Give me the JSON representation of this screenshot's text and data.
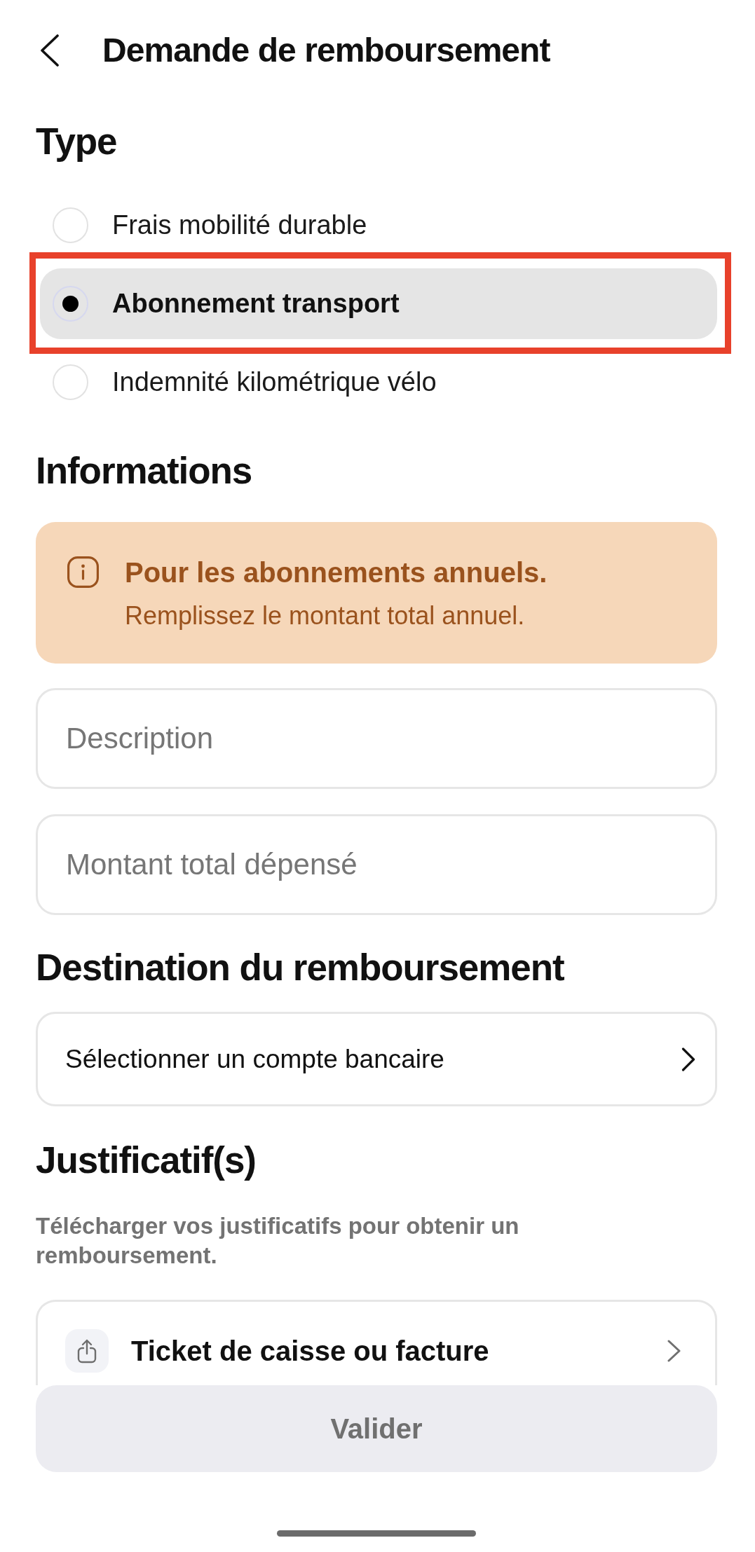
{
  "header": {
    "title": "Demande de remboursement"
  },
  "type_section": {
    "heading": "Type",
    "options": [
      {
        "label": "Frais mobilité durable",
        "selected": false,
        "highlighted": false
      },
      {
        "label": "Abonnement transport",
        "selected": true,
        "highlighted": true
      },
      {
        "label": "Indemnité kilométrique vélo",
        "selected": false,
        "highlighted": false
      }
    ]
  },
  "informations_section": {
    "heading": "Informations",
    "notice": {
      "title": "Pour les abonnements annuels.",
      "text": "Remplissez le montant total annuel."
    },
    "fields": [
      {
        "placeholder": "Description"
      },
      {
        "placeholder": "Montant total dépensé"
      }
    ]
  },
  "destination_section": {
    "heading": "Destination du remboursement",
    "select": {
      "label": "Sélectionner un compte bancaire"
    }
  },
  "justificatifs_section": {
    "heading": "Justificatif(s)",
    "description": "Télécharger vos justificatifs pour obtenir un remboursement.",
    "upload": {
      "label": "Ticket de caisse ou facture"
    }
  },
  "submit_button": {
    "label": "Valider",
    "disabled": true
  }
}
